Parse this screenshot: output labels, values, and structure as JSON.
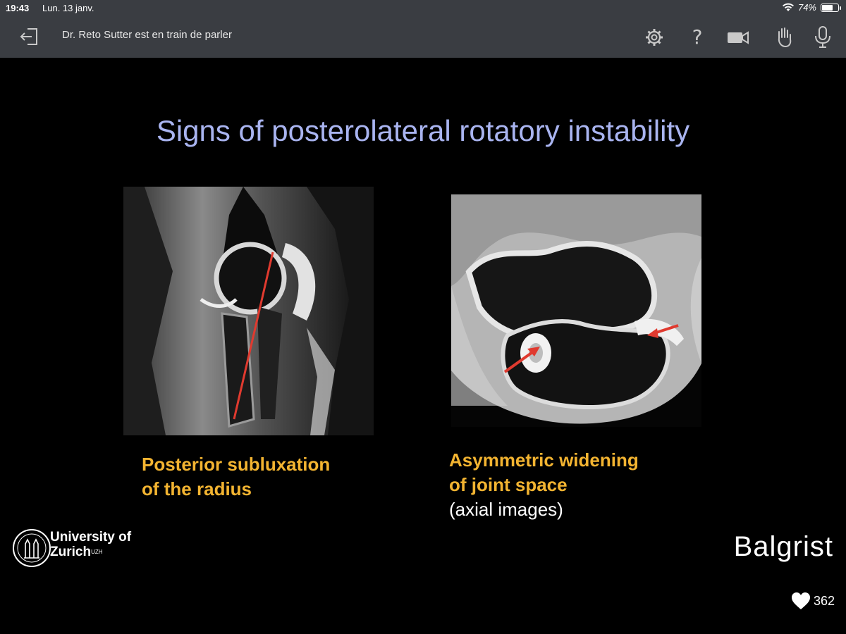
{
  "status": {
    "time": "19:43",
    "date": "Lun. 13 janv.",
    "battery": "74%",
    "battery_level": 0.74
  },
  "header": {
    "speaker": "Dr. Reto Sutter est en train de parler",
    "icons": [
      "exit-icon",
      "gear-icon",
      "help-icon",
      "camera-icon",
      "raise-hand-icon",
      "microphone-icon"
    ],
    "help_glyph": "?"
  },
  "slide": {
    "title": "Signs of posterolateral rotatory instability",
    "left_caption": [
      "Posterior subluxation",
      "of the radius"
    ],
    "right_caption": [
      "Asymmetric widening",
      "of joint space"
    ],
    "right_note": "(axial images)",
    "logo_left": {
      "line1": "University of",
      "line2": "Zurich",
      "sup": "UZH"
    },
    "logo_right": "Balgrist",
    "annotation_color": "#e03a2f"
  },
  "reactions": {
    "likes": "362"
  }
}
